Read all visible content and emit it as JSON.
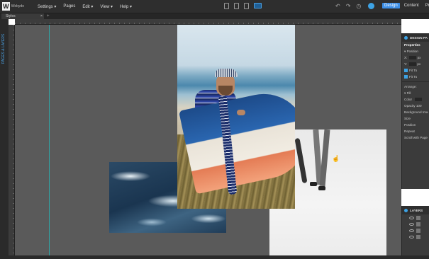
{
  "app": {
    "logo_mark": "W",
    "logo_text": "Webydo"
  },
  "menu": [
    {
      "label": "Settings ▾"
    },
    {
      "label": "Pages"
    },
    {
      "label": "Edit ▾"
    },
    {
      "label": "View ▾"
    },
    {
      "label": "Help ▾"
    }
  ],
  "modes": {
    "design": "Design",
    "content": "Content",
    "preview": "Preview"
  },
  "tab": {
    "label": "Styles",
    "close": "×",
    "add": "+"
  },
  "left_nav_label": "PAGES & LAYERS",
  "colors": {
    "accent": "#3d8ee6",
    "guide": "#2fa6a6",
    "canvas": "#5a5a5a"
  },
  "panel": {
    "header": "DESIGN PA",
    "properties": "Properties",
    "position": "▾ Position",
    "x_label": "X:",
    "x_val": "0",
    "x_unit": "px",
    "y_label": "Y:",
    "y_val": "0",
    "y_unit": "px",
    "fit1": "Fit To",
    "fit2": "Fit To",
    "arrange": "Arrange:",
    "fill": "▾ Fill",
    "color": "Color",
    "color_val": "Sc",
    "opacity": "Opacity",
    "opacity_val": "100",
    "bg_image": "Background Ima",
    "size": "Size",
    "position2": "Position",
    "repeat": "Repeat",
    "scroll": "Scroll with Page"
  },
  "layers": {
    "header": "LAYERS"
  }
}
